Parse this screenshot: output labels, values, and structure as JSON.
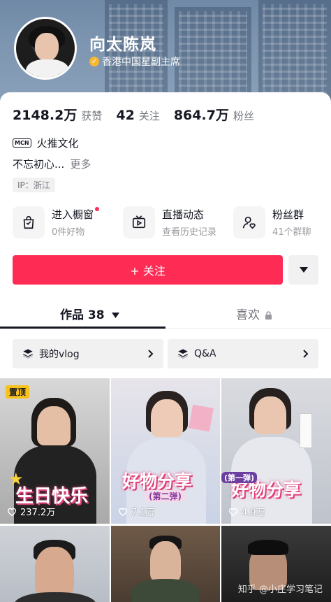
{
  "profile": {
    "name": "向太陈岚",
    "verified_title": "香港中国星副主席"
  },
  "stats": {
    "likes_value": "2148.2万",
    "likes_label": "获赞",
    "following_value": "42",
    "following_label": "关注",
    "followers_value": "864.7万",
    "followers_label": "粉丝"
  },
  "mcn": {
    "icon_text": "MCN",
    "agency": "火推文化"
  },
  "bio": {
    "text": "不忘初心...",
    "more_label": "更多"
  },
  "ip_label": "IP：浙江",
  "shortcuts": [
    {
      "title": "进入橱窗",
      "subtitle": "0件好物",
      "icon": "shopping-bag-icon"
    },
    {
      "title": "直播动态",
      "subtitle": "查看历史记录",
      "icon": "tv-play-icon"
    },
    {
      "title": "粉丝群",
      "subtitle": "41个群聊",
      "icon": "fan-group-icon"
    }
  ],
  "follow_button": "+ 关注",
  "tabs": {
    "works": "作品 38",
    "likes": "喜欢"
  },
  "collections": [
    {
      "label": "我的vlog",
      "icon": "stack-icon"
    },
    {
      "label": "Q&A",
      "icon": "stack-icon"
    }
  ],
  "videos": [
    {
      "pinned_label": "置顶",
      "overlay_text": "生日快乐",
      "likes": "237.2万"
    },
    {
      "overlay_text": "好物分享",
      "overlay_sub": "(第二弹)",
      "likes": "7.1万"
    },
    {
      "overlay_text": "好物分享",
      "overlay_sub": "(第一弹)",
      "likes": "4.9万"
    },
    {},
    {},
    {}
  ],
  "watermark": "知乎 @小庄学习笔记",
  "colors": {
    "accent": "#fe2c55",
    "pin": "#f8c21c",
    "text_primary": "#161823",
    "text_secondary": "#75777d"
  }
}
